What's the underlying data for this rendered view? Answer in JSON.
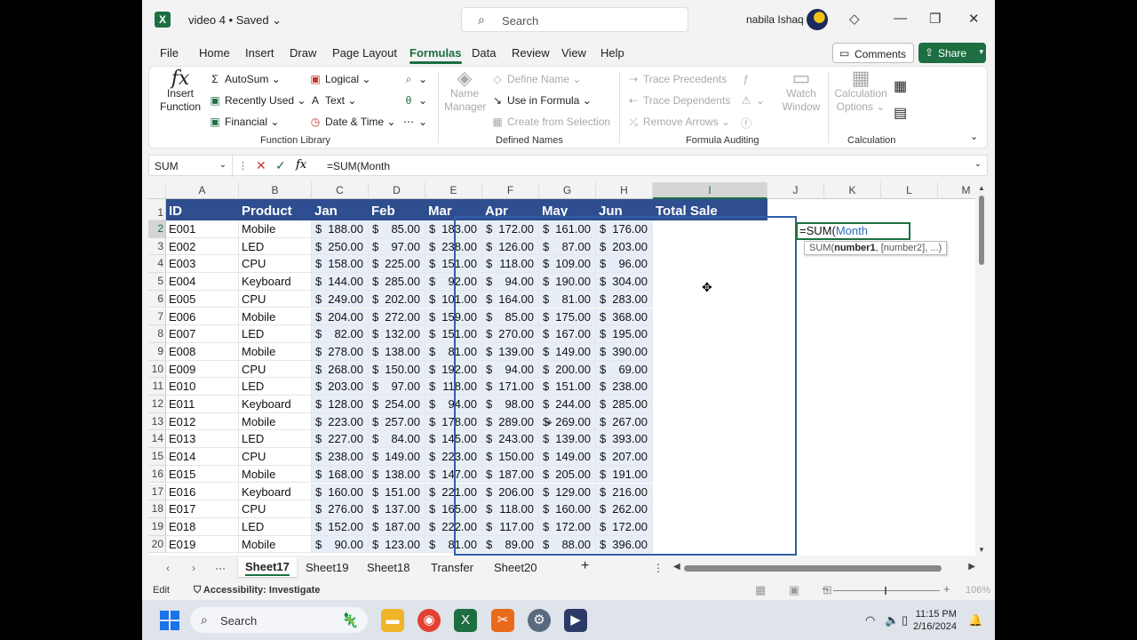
{
  "titlebar": {
    "doc_title": "video 4 • Saved ⌄",
    "search_placeholder": "Search",
    "user_name": "nabila Ishaq"
  },
  "menu": [
    "File",
    "Home",
    "Insert",
    "Draw",
    "Page Layout",
    "Formulas",
    "Data",
    "Review",
    "View",
    "Help"
  ],
  "menu_active": "Formulas",
  "actions": {
    "comments": "Comments",
    "share": "Share"
  },
  "ribbon": {
    "insert_function": [
      "Insert",
      "Function"
    ],
    "function_library": {
      "autosum": "AutoSum",
      "recently_used": "Recently Used",
      "financial": "Financial",
      "logical": "Logical",
      "text": "Text",
      "date_time": "Date & Time",
      "label": "Function Library"
    },
    "defined_names": {
      "name_manager": [
        "Name",
        "Manager"
      ],
      "define_name": "Define Name",
      "use_in_formula": "Use in Formula",
      "create_from_selection": "Create from Selection",
      "label": "Defined Names"
    },
    "formula_auditing": {
      "trace_precedents": "Trace Precedents",
      "trace_dependents": "Trace Dependents",
      "remove_arrows": "Remove Arrows",
      "watch_window": [
        "Watch",
        "Window"
      ],
      "label": "Formula Auditing"
    },
    "calculation": {
      "calc_options": [
        "Calculation",
        "Options ⌄"
      ],
      "label": "Calculation"
    }
  },
  "formula_bar": {
    "name_box": "SUM",
    "formula": "=SUM(Month"
  },
  "columns": [
    "A",
    "B",
    "C",
    "D",
    "E",
    "F",
    "G",
    "H",
    "I",
    "J",
    "K",
    "L",
    "M"
  ],
  "header_row": [
    "ID",
    "Product",
    "Jan",
    "Feb",
    "Mar",
    "Apr",
    "May",
    "Jun",
    "Total Sale"
  ],
  "rows": [
    {
      "id": "E001",
      "product": "Mobile",
      "values": [
        "188.00",
        "85.00",
        "183.00",
        "172.00",
        "161.00",
        "176.00"
      ]
    },
    {
      "id": "E002",
      "product": "LED",
      "values": [
        "250.00",
        "97.00",
        "238.00",
        "126.00",
        "87.00",
        "203.00"
      ]
    },
    {
      "id": "E003",
      "product": "CPU",
      "values": [
        "158.00",
        "225.00",
        "151.00",
        "118.00",
        "109.00",
        "96.00"
      ]
    },
    {
      "id": "E004",
      "product": "Keyboard",
      "values": [
        "144.00",
        "285.00",
        "92.00",
        "94.00",
        "190.00",
        "304.00"
      ]
    },
    {
      "id": "E005",
      "product": "CPU",
      "values": [
        "249.00",
        "202.00",
        "101.00",
        "164.00",
        "81.00",
        "283.00"
      ]
    },
    {
      "id": "E006",
      "product": "Mobile",
      "values": [
        "204.00",
        "272.00",
        "159.00",
        "85.00",
        "175.00",
        "368.00"
      ]
    },
    {
      "id": "E007",
      "product": "LED",
      "values": [
        "82.00",
        "132.00",
        "151.00",
        "270.00",
        "167.00",
        "195.00"
      ]
    },
    {
      "id": "E008",
      "product": "Mobile",
      "values": [
        "278.00",
        "138.00",
        "81.00",
        "139.00",
        "149.00",
        "390.00"
      ]
    },
    {
      "id": "E009",
      "product": "CPU",
      "values": [
        "268.00",
        "150.00",
        "192.00",
        "94.00",
        "200.00",
        "69.00"
      ]
    },
    {
      "id": "E010",
      "product": "LED",
      "values": [
        "203.00",
        "97.00",
        "118.00",
        "171.00",
        "151.00",
        "238.00"
      ]
    },
    {
      "id": "E011",
      "product": "Keyboard",
      "values": [
        "128.00",
        "254.00",
        "94.00",
        "98.00",
        "244.00",
        "285.00"
      ]
    },
    {
      "id": "E012",
      "product": "Mobile",
      "values": [
        "223.00",
        "257.00",
        "178.00",
        "289.00",
        "269.00",
        "267.00"
      ]
    },
    {
      "id": "E013",
      "product": "LED",
      "values": [
        "227.00",
        "84.00",
        "145.00",
        "243.00",
        "139.00",
        "393.00"
      ]
    },
    {
      "id": "E014",
      "product": "CPU",
      "values": [
        "238.00",
        "149.00",
        "223.00",
        "150.00",
        "149.00",
        "207.00"
      ]
    },
    {
      "id": "E015",
      "product": "Mobile",
      "values": [
        "168.00",
        "138.00",
        "147.00",
        "187.00",
        "205.00",
        "191.00"
      ]
    },
    {
      "id": "E016",
      "product": "Keyboard",
      "values": [
        "160.00",
        "151.00",
        "221.00",
        "206.00",
        "129.00",
        "216.00"
      ]
    },
    {
      "id": "E017",
      "product": "CPU",
      "values": [
        "276.00",
        "137.00",
        "165.00",
        "118.00",
        "160.00",
        "262.00"
      ]
    },
    {
      "id": "E018",
      "product": "LED",
      "values": [
        "152.00",
        "187.00",
        "222.00",
        "117.00",
        "172.00",
        "172.00"
      ]
    },
    {
      "id": "E019",
      "product": "Mobile",
      "values": [
        "90.00",
        "123.00",
        "81.00",
        "89.00",
        "88.00",
        "396.00"
      ]
    }
  ],
  "currency_symbol": "$",
  "active_cell": {
    "prefix": "=SUM(",
    "ref": "Month"
  },
  "tooltip": {
    "fn": "SUM(",
    "arg1": "number1",
    "rest": ", [number2], ...)"
  },
  "sheets": [
    "Sheet17",
    "Sheet19",
    "Sheet18",
    "Transfer",
    "Sheet20"
  ],
  "active_sheet": "Sheet17",
  "status": {
    "mode": "Edit",
    "accessibility": "Accessibility: Investigate",
    "zoom": "106%"
  },
  "taskbar": {
    "search": "Search",
    "time": "11:15 PM",
    "date": "2/16/2024"
  },
  "colors": {
    "accent": "#1d6f42",
    "header_fill": "#2f4e8f",
    "range_ref": "#2f6ebd"
  }
}
